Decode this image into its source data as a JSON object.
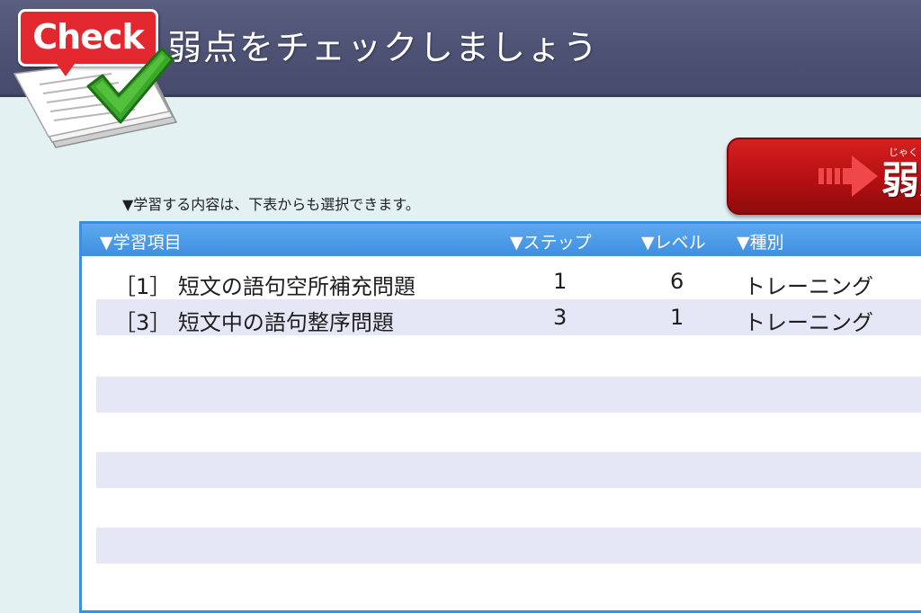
{
  "header": {
    "logo_text": "Check",
    "title": "弱点をチェックしましょう"
  },
  "start_button": {
    "ruby": "じゃく",
    "label": "弱点"
  },
  "instruction": "▼学習する内容は、下表からも選択できます。",
  "table": {
    "columns": [
      "▼学習項目",
      "▼ステップ",
      "▼レベル",
      "▼種別"
    ],
    "rows": [
      {
        "item": "［1］ 短文の語句空所補充問題",
        "step": "1",
        "level": "6",
        "type": "トレーニング"
      },
      {
        "item": "［3］ 短文中の語句整序問題",
        "step": "3",
        "level": "1",
        "type": "トレーニング"
      }
    ]
  },
  "colors": {
    "header_bg": "#4d5173",
    "table_header": "#3e8fe2",
    "row_alt": "#e6e7f6",
    "button_red": "#c41417",
    "badge_red": "#e3272f",
    "check_green": "#3aa82a"
  }
}
